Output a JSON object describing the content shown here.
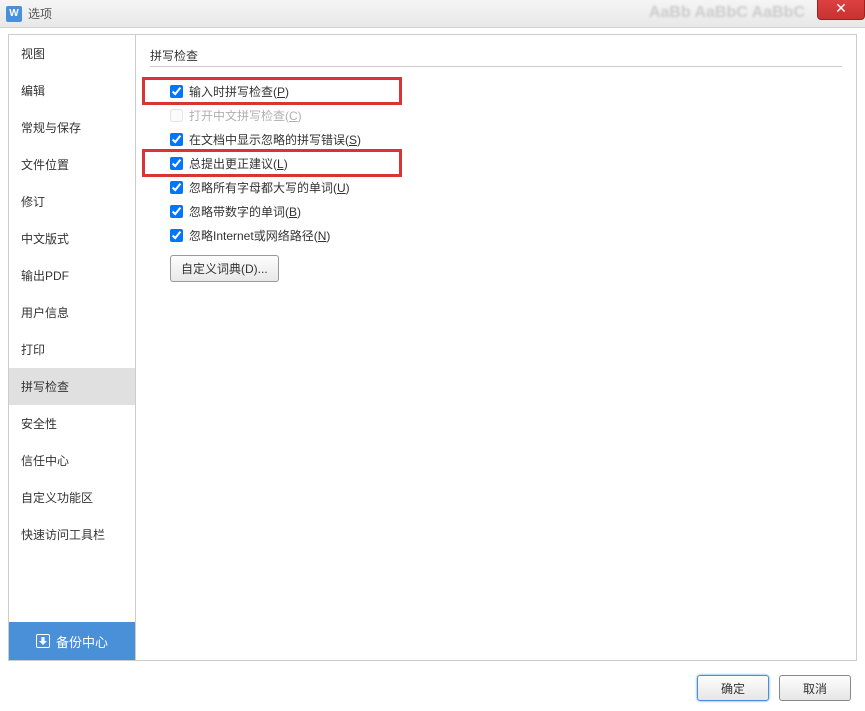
{
  "title": "选项",
  "app_icon_text": "W",
  "close_symbol": "✕",
  "sidebar": {
    "items": [
      {
        "label": "视图",
        "selected": false
      },
      {
        "label": "编辑",
        "selected": false
      },
      {
        "label": "常规与保存",
        "selected": false
      },
      {
        "label": "文件位置",
        "selected": false
      },
      {
        "label": "修订",
        "selected": false
      },
      {
        "label": "中文版式",
        "selected": false
      },
      {
        "label": "输出PDF",
        "selected": false
      },
      {
        "label": "用户信息",
        "selected": false
      },
      {
        "label": "打印",
        "selected": false
      },
      {
        "label": "拼写检查",
        "selected": true
      },
      {
        "label": "安全性",
        "selected": false
      },
      {
        "label": "信任中心",
        "selected": false
      },
      {
        "label": "自定义功能区",
        "selected": false
      },
      {
        "label": "快速访问工具栏",
        "selected": false
      }
    ],
    "backup_label": "备份中心"
  },
  "main": {
    "section_title": "拼写检查",
    "options": [
      {
        "label": "输入时拼写检查(",
        "accel": "P",
        "suffix": ")",
        "checked": true,
        "disabled": false,
        "highlighted": true
      },
      {
        "label": "打开中文拼写检查(",
        "accel": "C",
        "suffix": ")",
        "checked": false,
        "disabled": true,
        "highlighted": false
      },
      {
        "label": "在文档中显示忽略的拼写错误(",
        "accel": "S",
        "suffix": ")",
        "checked": true,
        "disabled": false,
        "highlighted": false
      },
      {
        "label": "总提出更正建议(",
        "accel": "L",
        "suffix": ")",
        "checked": true,
        "disabled": false,
        "highlighted": true
      },
      {
        "label": "忽略所有字母都大写的单词(",
        "accel": "U",
        "suffix": ")",
        "checked": true,
        "disabled": false,
        "highlighted": false
      },
      {
        "label": "忽略带数字的单词(",
        "accel": "B",
        "suffix": ")",
        "checked": true,
        "disabled": false,
        "highlighted": false
      },
      {
        "label": "忽略Internet或网络路径(",
        "accel": "N",
        "suffix": ")",
        "checked": true,
        "disabled": false,
        "highlighted": false
      }
    ],
    "custom_dict_label": "自定义词典(D)..."
  },
  "footer": {
    "ok_label": "确定",
    "cancel_label": "取消"
  },
  "bg_blur_text": "AaBb AaBbC AaBbC"
}
